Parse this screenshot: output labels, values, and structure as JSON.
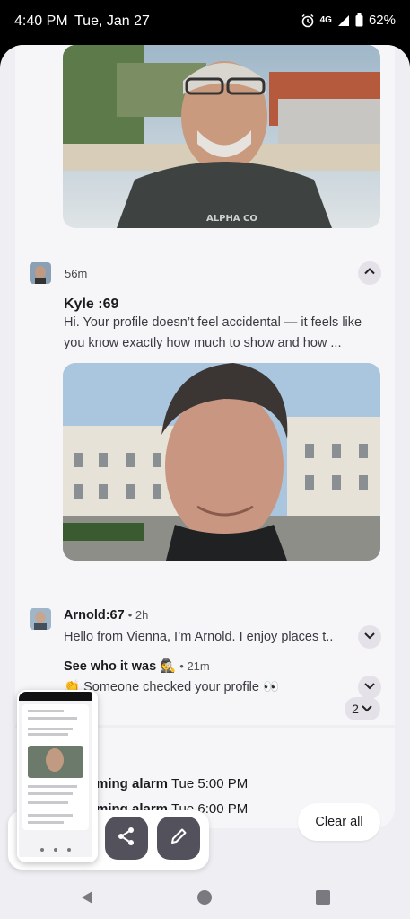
{
  "status_bar": {
    "time": "4:40 PM",
    "date": "Tue, Jan 27",
    "network": "4G",
    "battery": "62%",
    "icons": [
      "alarm-icon",
      "lte-icon",
      "signal-icon",
      "battery-icon"
    ]
  },
  "notifications": {
    "kyle": {
      "time": "56m",
      "title": "Kyle :69",
      "body": "Hi.  Your profile doesn’t feel accidental — it feels like you know exactly how much to show and how ..."
    },
    "arnold": {
      "title": "Arnold:67",
      "time": "2h",
      "body": "Hello from Vienna, I’m Arnold. I enjoy places t.."
    },
    "see_who": {
      "title": "See who it was 🕵",
      "time": "21m",
      "body": "👏 Someone checked your profile 👀"
    },
    "alarm_group": {
      "count": "2",
      "alarms": [
        {
          "label": "ming alarm",
          "time": "Tue 5:00 PM"
        },
        {
          "label": "ming alarm",
          "time": "Tue 6:00 PM"
        }
      ]
    }
  },
  "actions": {
    "clear_all": "Clear all"
  },
  "colors": {
    "panel_bg": "#efeef2",
    "card_bg": "#f6f5f8",
    "fab_bg": "#53525c"
  }
}
